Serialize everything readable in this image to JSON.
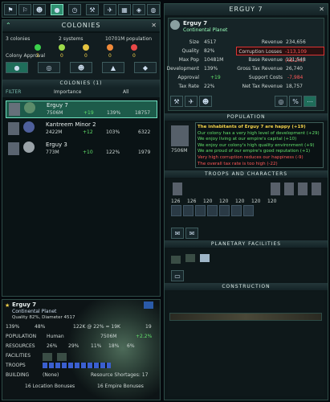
{
  "topbar": {
    "icons": [
      "flag-icon",
      "flags-icon",
      "person-icon",
      "planet-icon",
      "gauge-icon",
      "pickaxe-icon",
      "ship-icon",
      "grid-icon",
      "shield-icon",
      "globe-icon",
      "cog-icon"
    ]
  },
  "colonies_panel": {
    "title": "COLONIES",
    "summary": {
      "colonies": "3 colonies",
      "systems": "2 systems",
      "population": "10701M population"
    },
    "approval_label": "Colony Approval",
    "approval_counts": [
      "3",
      "0",
      "0",
      "0",
      "0"
    ],
    "filter_label": "FILTER",
    "sort_label": "Importance",
    "show_label": "All",
    "list_header": "COLONIES (1)",
    "rows": [
      {
        "name": "Erguy 7",
        "pop": "7506M",
        "approval": "+19",
        "development": "139%",
        "money": "18757"
      },
      {
        "name": "Kantreem Minor 2",
        "pop": "2422M",
        "approval": "+12",
        "development": "103%",
        "money": "6322"
      },
      {
        "name": "Erguy 3",
        "pop": "773M",
        "approval": "+10",
        "development": "122%",
        "money": "1979"
      }
    ]
  },
  "detail": {
    "title": "ERGUY 7",
    "name": "Erguy 7",
    "type": "Continental Planet",
    "stats_left": [
      {
        "label": "Size",
        "value": "4517"
      },
      {
        "label": "Quality",
        "value": "82%"
      },
      {
        "label": "Max Pop",
        "value": "10481M"
      },
      {
        "label": "Development",
        "value": "139%"
      },
      {
        "label": "Approval",
        "value": "+19"
      },
      {
        "label": "Tax Rate",
        "value": "22%"
      }
    ],
    "stats_right": [
      {
        "label": "Revenue",
        "value": "234,656"
      },
      {
        "label": "Corruption Losses",
        "value": "-113,109 (48.2%)"
      },
      {
        "label": "Base Revenue",
        "value": "121,548"
      },
      {
        "label": "Gross Tax Revenue",
        "value": "26,740"
      },
      {
        "label": "Support Costs",
        "value": "-7,984"
      },
      {
        "label": "Net Tax Revenue",
        "value": "18,757"
      }
    ],
    "population_header": "POPULATION",
    "pop_value": "7506M",
    "happiness_title": "The inhabitants of Erguy 7 are happy (+19)",
    "happiness_lines": [
      "Our colony has a very high level of development (+29)",
      "We enjoy living at our empire's capital (+10)",
      "We enjoy our colony's high quality environment (+9)",
      "We are proud of our empire's good reputation (+1)",
      "Very high corruption reduces our happiness (-9)",
      "The overall tax rate is too high (-22)"
    ],
    "troops_header": "TROOPS AND CHARACTERS",
    "troop_values": [
      "126",
      "126",
      "120",
      "120",
      "120",
      "120",
      "120"
    ],
    "facilities_header": "PLANETARY FACILITIES",
    "construction_header": "CONSTRUCTION"
  },
  "bottom": {
    "name": "Erguy 7",
    "type": "Continental Planet",
    "quality": "Quality 82%, Diameter 4517",
    "development": "139%",
    "approval_pct": "48%",
    "money": "122K @ 22% = 19K",
    "troops_count": "19",
    "population_label": "POPULATION",
    "race": "Human",
    "pop": "7506M",
    "growth": "+2.2%",
    "resources_label": "RESOURCES",
    "res_values": [
      "26%",
      "29%",
      "11%",
      "18%",
      "6%"
    ],
    "facilities_label": "FACILITIES",
    "troops_label": "TROOPS",
    "building_label": "BUILDING",
    "building_value": "(None)",
    "shortages": "Resource Shortages: 17",
    "location_bonuses": "16 Location Bonuses",
    "empire_bonuses": "16 Empire Bonuses"
  },
  "colors": {
    "accent": "#1f6d5a",
    "selected": "#1d5b4a",
    "positive": "#62e06b",
    "negative": "#ff5858"
  }
}
